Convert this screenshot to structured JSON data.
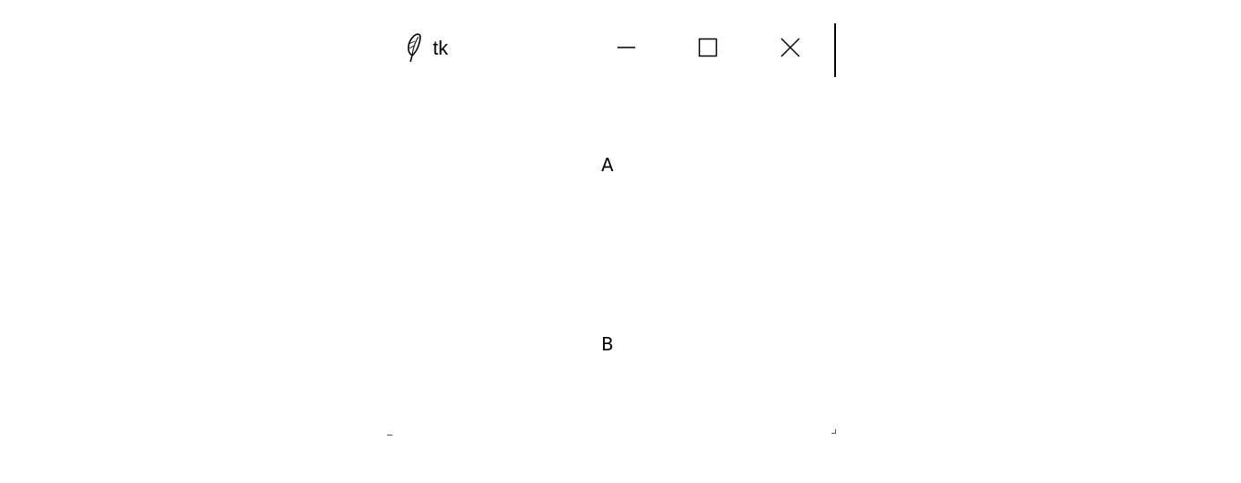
{
  "window": {
    "title": "tk",
    "app_icon": "tk-feather-icon",
    "controls": {
      "minimize_icon": "minimize-icon",
      "maximize_icon": "maximize-icon",
      "close_icon": "close-icon"
    }
  },
  "content": {
    "label_a": "A",
    "label_b": "B"
  }
}
